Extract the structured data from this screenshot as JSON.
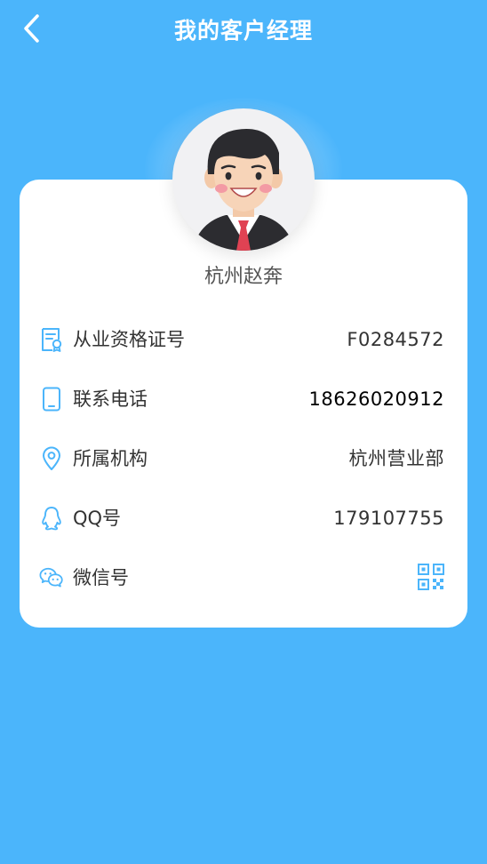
{
  "header": {
    "title": "我的客户经理"
  },
  "manager": {
    "name": "杭州赵奔"
  },
  "rows": [
    {
      "icon": "certificate-icon",
      "label": "从业资格证号",
      "value": "F0284572"
    },
    {
      "icon": "phone-icon",
      "label": "联系电话",
      "value": "18626020912"
    },
    {
      "icon": "location-pin-icon",
      "label": "所属机构",
      "value": "杭州营业部"
    },
    {
      "icon": "qq-icon",
      "label": "QQ号",
      "value": "179107755"
    },
    {
      "icon": "wechat-icon",
      "label": "微信号",
      "value": ""
    }
  ],
  "colors": {
    "background": "#4bb5fb",
    "icon": "#4bb5fb",
    "card": "#ffffff",
    "text": "#333333"
  }
}
